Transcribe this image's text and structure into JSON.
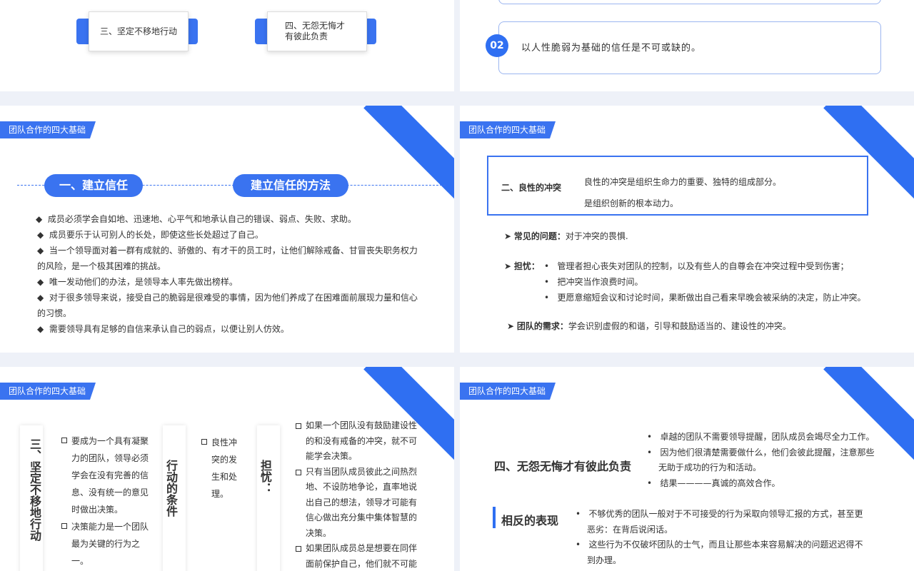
{
  "s1": {
    "box3": "三、坚定不移地行动",
    "box4": "四、无怨无悔才有彼此负责"
  },
  "s2": {
    "num": "02",
    "text": "以人性脆弱为基础的信任是不可或缺的。"
  },
  "tag": "团队合作的四大基础",
  "s3": {
    "pill_left": "一、建立信任",
    "pill_right": "建立信任的方法",
    "bullets": [
      "成员必须学会自如地、迅速地、心平气和地承认自己的错误、弱点、失败、求助。",
      "成员要乐于认可别人的长处，即使这些长处超过了自己。",
      "当一个领导面对着一群有成就的、骄傲的、有才干的员工时，让他们解除戒备、甘冒丧失职务权力的风险，是一个极其困难的挑战。",
      "唯一发动他们的办法，是领导本人率先做出榜样。",
      "对于很多领导来说，接受自己的脆弱是很难受的事情，因为他们养成了在困难面前展现力量和信心的习惯。",
      "需要领导具有足够的自信来承认自己的弱点，以便让别人仿效。"
    ]
  },
  "s4": {
    "title": "二、良性的冲突",
    "desc1": "良性的冲突是组织生命力的重要、独特的组成部分。",
    "desc2": "是组织创新的根本动力。",
    "q_label": "常见的问题：",
    "q_text": "对于冲突的畏惧.",
    "w_label": "担忧：",
    "worries": [
      "管理者担心丧失对团队的控制，以及有些人的自尊会在冲突过程中受到伤害；",
      "把冲突当作浪费时间。",
      "更愿意缩短会议和讨论时间，果断做出自己看来早晚会被采纳的决定，防止冲突。"
    ],
    "n_label": "团队的需求：",
    "n_text": "学会识别虚假的和谐，引导和鼓励适当的、建设性的冲突。"
  },
  "s5": {
    "title": "三、坚定不移地行动",
    "col1": [
      "要成为一个具有凝聚力的团队，领导必须学会在没有完善的信息、没有统一的意见时做出决策。",
      "决策能力是一个团队最为关键的行为之一。"
    ],
    "cond_title": "行动的条件",
    "col2": [
      "良性冲突的发生和处理。"
    ],
    "worry_title": "担忧：",
    "col3": [
      "如果一个团队没有鼓励建设性的和没有戒备的冲突，就不可能学会决策。",
      "只有当团队成员彼此之间热烈地、不设防地争论，直率地说出自己的想法，领导才可能有信心做出充分集中集体智慧的决策。",
      "如果团队成员总是想要在同伴面前保护自己，他们就不可能"
    ]
  },
  "s6": {
    "title": "四、无怨无悔才有彼此负责",
    "top": [
      "卓越的团队不需要领导提醒，团队成员会竭尽全力工作。",
      "因为他们很清楚需要做什么，他们会彼此提醒，注意那些无助于成功的行为和活动。",
      "结果————真诚的高效合作。"
    ],
    "opp_title": "相反的表现",
    "bottom": [
      "不够优秀的团队一般对于不可接受的行为采取向领导汇报的方式，甚至更恶劣：在背后说闲话。",
      "这些行为不仅破坏团队的士气，而且让那些本来容易解决的问题迟迟得不到办理。"
    ]
  }
}
